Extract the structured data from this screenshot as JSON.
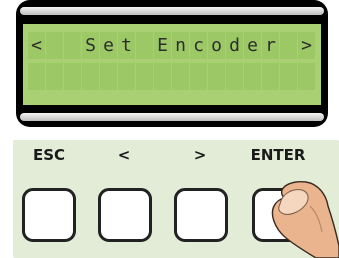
{
  "display": {
    "cells": [
      [
        "<",
        "",
        "",
        "S",
        "e",
        "t",
        "",
        "E",
        "n",
        "c",
        "o",
        "d",
        "e",
        "r",
        "",
        ">"
      ],
      [
        "",
        "",
        "",
        "",
        "",
        "",
        "",
        "",
        "",
        "",
        "",
        "",
        "",
        "",
        "",
        ""
      ]
    ]
  },
  "keypad": {
    "labels": {
      "esc": "ESC",
      "left": "<",
      "right": ">",
      "enter": "ENTER"
    }
  },
  "colors": {
    "lcd_background": "#a9d072",
    "lcd_cell": "#9cc865",
    "lcd_text": "#2d2d2d",
    "keypad_background": "#e2ecd7"
  },
  "icons": {
    "pressing_finger": "finger-press-icon"
  }
}
